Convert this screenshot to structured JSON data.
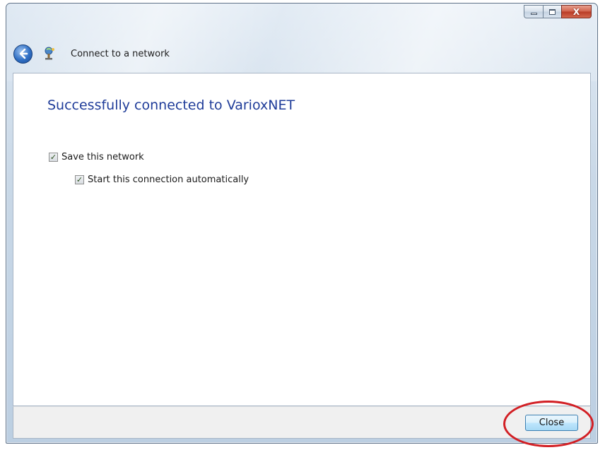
{
  "window": {
    "caption_buttons": {
      "minimize_icon": "minimize-icon",
      "maximize_icon": "maximize-icon",
      "close_glyph": "X"
    }
  },
  "nav": {
    "back_icon": "back-arrow-icon",
    "network_icon": "network-wizard-icon",
    "title": "Connect to a network"
  },
  "main": {
    "heading": "Successfully connected to VarioxNET",
    "options": [
      {
        "label": "Save this network",
        "checked": true
      },
      {
        "label": "Start this connection automatically",
        "checked": true
      }
    ]
  },
  "footer": {
    "close_label": "Close"
  },
  "colors": {
    "heading": "#1f3c99",
    "highlight": "#d21f24",
    "close_caption": "#c8452f"
  }
}
